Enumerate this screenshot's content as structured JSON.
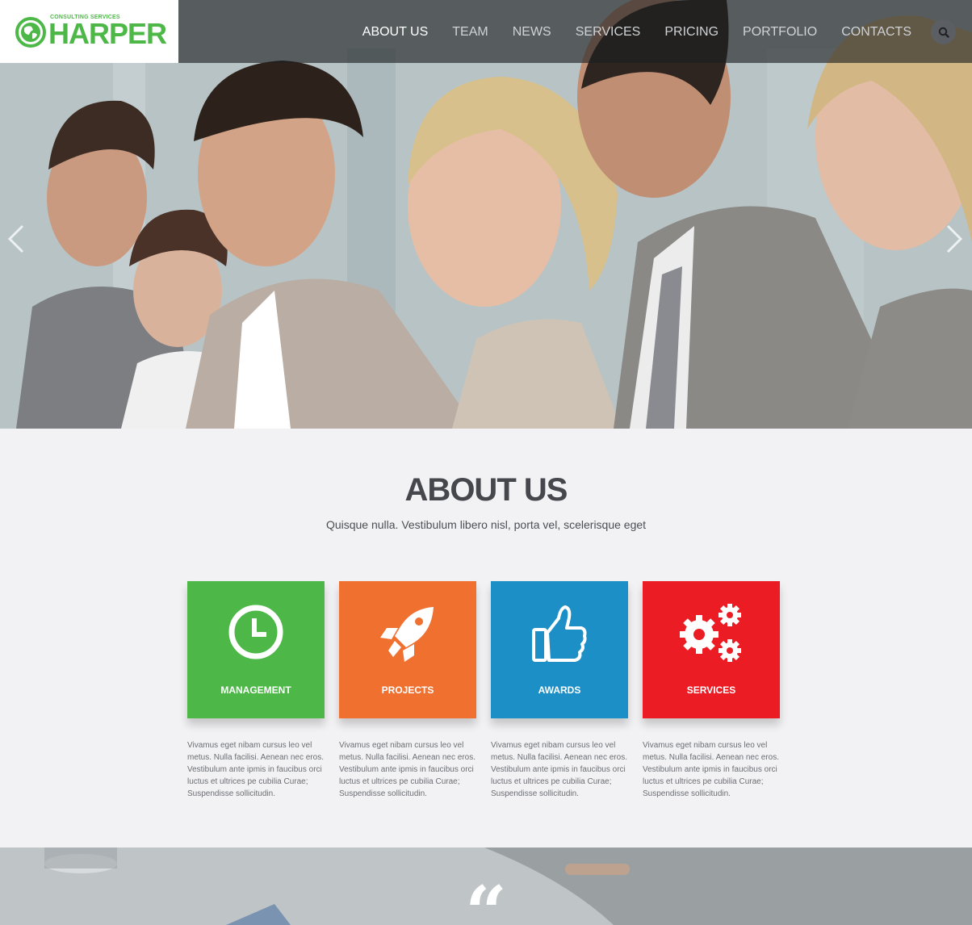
{
  "brand": {
    "tagline": "CONSULTING SERVICES",
    "name": "HARPER",
    "accent_color": "#4db848"
  },
  "nav": {
    "items": [
      {
        "label": "ABOUT US",
        "active": true
      },
      {
        "label": "TEAM",
        "active": false
      },
      {
        "label": "NEWS",
        "active": false
      },
      {
        "label": "SERVICES",
        "active": false
      },
      {
        "label": "PRICING",
        "active": false
      },
      {
        "label": "PORTFOLIO",
        "active": false
      },
      {
        "label": "CONTACTS",
        "active": false
      }
    ],
    "search_icon": "search-icon"
  },
  "slider": {
    "prev_icon": "chevron-left-icon",
    "next_icon": "chevron-right-icon"
  },
  "about": {
    "title": "ABOUT US",
    "subtitle": "Quisque nulla. Vestibulum libero nisl, porta vel, scelerisque eget",
    "tiles": [
      {
        "label": "MANAGEMENT",
        "icon": "clock-icon",
        "color": "#4db848",
        "text": "Vivamus eget nibam cursus leo vel metus. Nulla facilisi. Aenean nec eros. Vestibulum ante ipmis in faucibus orci luctus et ultrices pe cubilia Curae; Suspendisse sollicitudin."
      },
      {
        "label": "PROJECTS",
        "icon": "rocket-icon",
        "color": "#f07030",
        "text": "Vivamus eget nibam cursus leo vel metus. Nulla facilisi. Aenean nec eros. Vestibulum ante ipmis in faucibus orci luctus et ultrices pe cubilia Curae; Suspendisse sollicitudin."
      },
      {
        "label": "AWARDS",
        "icon": "thumbs-up-icon",
        "color": "#1b8fc6",
        "text": "Vivamus eget nibam cursus leo vel metus. Nulla facilisi. Aenean nec eros. Vestibulum ante ipmis in faucibus orci luctus et ultrices pe cubilia Curae; Suspendisse sollicitudin."
      },
      {
        "label": "SERVICES",
        "icon": "gears-icon",
        "color": "#ec1c24",
        "text": "Vivamus eget nibam cursus leo vel metus. Nulla facilisi. Aenean nec eros. Vestibulum ante ipmis in faucibus orci luctus et ultrices pe cubilia Curae; Suspendisse sollicitudin."
      }
    ]
  },
  "testimonial": {
    "quote_mark": "“"
  }
}
